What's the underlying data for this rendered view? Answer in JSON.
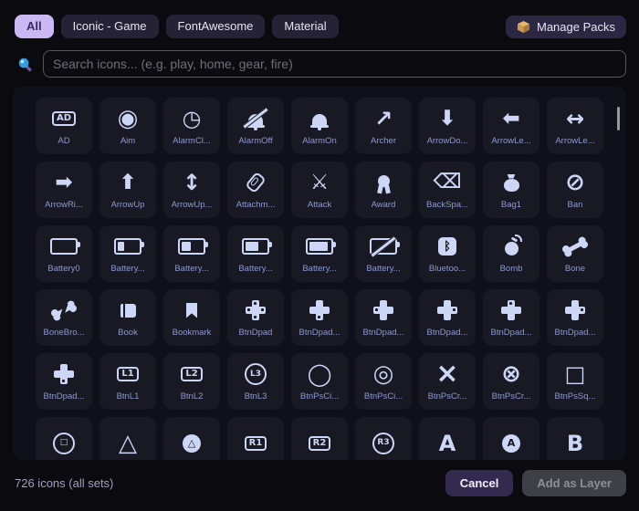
{
  "tabs": [
    {
      "label": "All",
      "active": true
    },
    {
      "label": "Iconic - Game",
      "active": false
    },
    {
      "label": "FontAwesome",
      "active": false
    },
    {
      "label": "Material",
      "active": false
    }
  ],
  "manage_packs": {
    "label": "Manage Packs",
    "icon": "package-icon"
  },
  "search": {
    "icon": "search-icon",
    "placeholder": "Search icons... (e.g. play, home, gear, fire)",
    "value": ""
  },
  "grid": {
    "icons": [
      {
        "name": "ad",
        "label": "AD",
        "kind": "boxtext",
        "text": "AD"
      },
      {
        "name": "aim",
        "label": "Aim",
        "kind": "glyph",
        "glyph": "◉",
        "size": 26
      },
      {
        "name": "alarm-clock",
        "label": "AlarmCl...",
        "kind": "glyph",
        "glyph": "◷",
        "size": 24
      },
      {
        "name": "alarm-off",
        "label": "AlarmOff",
        "kind": "bell",
        "off": true
      },
      {
        "name": "alarm-on",
        "label": "AlarmOn",
        "kind": "bell"
      },
      {
        "name": "archer",
        "label": "Archer",
        "kind": "glyph",
        "glyph": "↗",
        "size": 24
      },
      {
        "name": "arrow-down",
        "label": "ArrowDo...",
        "kind": "glyph",
        "glyph": "⬇",
        "size": 23
      },
      {
        "name": "arrow-left",
        "label": "ArrowLe...",
        "kind": "glyph",
        "glyph": "⬅",
        "size": 23
      },
      {
        "name": "arrow-left-right",
        "label": "ArrowLe...",
        "kind": "glyph",
        "glyph": "↔",
        "size": 24
      },
      {
        "name": "arrow-right",
        "label": "ArrowRi...",
        "kind": "glyph",
        "glyph": "➡",
        "size": 23
      },
      {
        "name": "arrow-up",
        "label": "ArrowUp",
        "kind": "glyph",
        "glyph": "⬆",
        "size": 23
      },
      {
        "name": "arrow-up-down",
        "label": "ArrowUp...",
        "kind": "glyph",
        "glyph": "↕",
        "size": 24
      },
      {
        "name": "attachment",
        "label": "Attachm...",
        "kind": "clip"
      },
      {
        "name": "attack",
        "label": "Attack",
        "kind": "glyph",
        "glyph": "⚔",
        "size": 23
      },
      {
        "name": "award",
        "label": "Award",
        "kind": "award"
      },
      {
        "name": "backspace",
        "label": "BackSpa...",
        "kind": "glyph",
        "glyph": "⌫",
        "size": 22
      },
      {
        "name": "bag",
        "label": "Bag1",
        "kind": "bag"
      },
      {
        "name": "ban",
        "label": "Ban",
        "kind": "glyph",
        "glyph": "⊘",
        "size": 26
      },
      {
        "name": "battery-0",
        "label": "Battery0",
        "kind": "battery",
        "fill": 0
      },
      {
        "name": "battery-1",
        "label": "Battery...",
        "kind": "battery",
        "fill": 0.25
      },
      {
        "name": "battery-2",
        "label": "Battery...",
        "kind": "battery",
        "fill": 0.4
      },
      {
        "name": "battery-3",
        "label": "Battery...",
        "kind": "battery",
        "fill": 0.55
      },
      {
        "name": "battery-4",
        "label": "Battery...",
        "kind": "battery",
        "fill": 0.75
      },
      {
        "name": "battery-x",
        "label": "Battery...",
        "kind": "battery",
        "fill": "x"
      },
      {
        "name": "bluetooth",
        "label": "Bluetoo...",
        "kind": "badge",
        "text": "ᛒ"
      },
      {
        "name": "bomb",
        "label": "Bomb",
        "kind": "bomb"
      },
      {
        "name": "bone",
        "label": "Bone",
        "kind": "bone"
      },
      {
        "name": "bone-broken",
        "label": "BoneBro...",
        "kind": "bone",
        "broken": true
      },
      {
        "name": "book",
        "label": "Book",
        "kind": "book"
      },
      {
        "name": "bookmark",
        "label": "Bookmark",
        "kind": "bookmark"
      },
      {
        "name": "dpad",
        "label": "BtnDpad",
        "kind": "dpad",
        "dir": "all"
      },
      {
        "name": "dpad-down",
        "label": "BtnDpad...",
        "kind": "dpad",
        "dir": "down"
      },
      {
        "name": "dpad-left",
        "label": "BtnDpad...",
        "kind": "dpad",
        "dir": "left"
      },
      {
        "name": "dpad-right",
        "label": "BtnDpad...",
        "kind": "dpad",
        "dir": "right"
      },
      {
        "name": "dpad-up",
        "label": "BtnDpad...",
        "kind": "dpad",
        "dir": "up"
      },
      {
        "name": "dpad-sides",
        "label": "BtnDpad...",
        "kind": "dpad",
        "dir": "right"
      },
      {
        "name": "dpad-solid",
        "label": "BtnDpad...",
        "kind": "dpad",
        "dir": "down"
      },
      {
        "name": "btn-l1",
        "label": "BtnL1",
        "kind": "boxtext",
        "text": "L1"
      },
      {
        "name": "btn-l2",
        "label": "BtnL2",
        "kind": "boxtext",
        "text": "L2"
      },
      {
        "name": "btn-l3",
        "label": "BtnL3",
        "kind": "circletext",
        "text": "L3"
      },
      {
        "name": "ps-circle",
        "label": "BtnPsCi...",
        "kind": "glyph",
        "glyph": "◯",
        "size": 24
      },
      {
        "name": "ps-circle-dot",
        "label": "BtnPsCi...",
        "kind": "glyph",
        "glyph": "◎",
        "size": 26
      },
      {
        "name": "ps-cross",
        "label": "BtnPsCr...",
        "kind": "glyph",
        "glyph": "×",
        "size": 30
      },
      {
        "name": "ps-cross-circle",
        "label": "BtnPsCr...",
        "kind": "glyph",
        "glyph": "⊗",
        "size": 26
      },
      {
        "name": "ps-square",
        "label": "BtnPsSq...",
        "kind": "glyph",
        "glyph": "□",
        "size": 24
      },
      {
        "name": "ps-square-circle",
        "label": "",
        "kind": "circletext",
        "text": "□"
      },
      {
        "name": "triangle",
        "label": "",
        "kind": "glyph",
        "glyph": "△",
        "size": 26
      },
      {
        "name": "triangle-circle",
        "label": "",
        "kind": "badge",
        "text": "△",
        "shape": "round"
      },
      {
        "name": "btn-r1",
        "label": "",
        "kind": "boxtext",
        "text": "R1"
      },
      {
        "name": "btn-r2",
        "label": "",
        "kind": "boxtext",
        "text": "R2"
      },
      {
        "name": "btn-r3",
        "label": "",
        "kind": "circletext",
        "text": "R3"
      },
      {
        "name": "btn-a",
        "label": "",
        "kind": "glyph",
        "glyph": "A",
        "size": 24
      },
      {
        "name": "btn-a-circle",
        "label": "",
        "kind": "badge",
        "text": "A",
        "shape": "round"
      },
      {
        "name": "btn-b",
        "label": "",
        "kind": "glyph",
        "glyph": "B",
        "size": 24
      }
    ]
  },
  "footer": {
    "count_text": "726 icons (all sets)",
    "cancel_label": "Cancel",
    "add_label": "Add as Layer"
  },
  "colors": {
    "background": "#0a0a0f",
    "panel": "#10101a",
    "cell": "#191923",
    "glyph": "#ccd6f6",
    "label": "#8d99cf",
    "tab_active_bg": "#c9b8f3",
    "tab_active_text": "#3a2a63",
    "tab_bg": "#252236",
    "cancel_bg": "#342a4f",
    "add_bg": "#3f3f46",
    "package_amber": "#e0aa60"
  }
}
